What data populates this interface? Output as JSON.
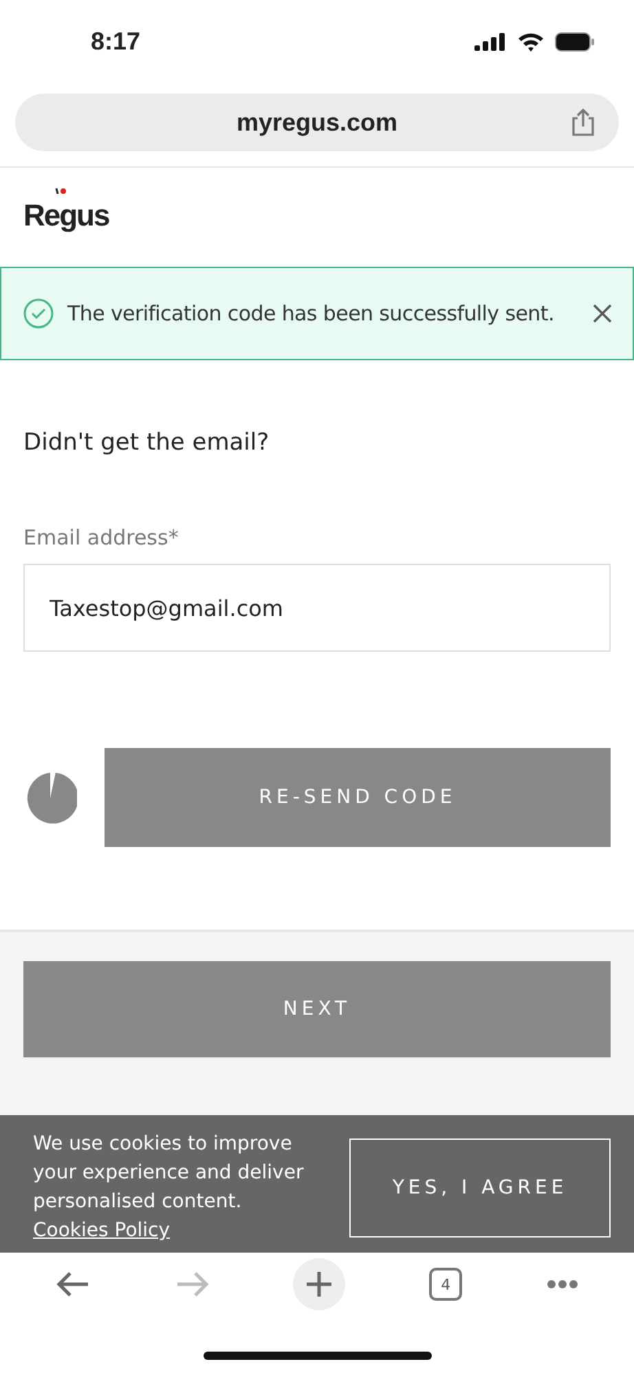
{
  "status_bar": {
    "time": "8:17"
  },
  "browser": {
    "url": "myregus.com"
  },
  "header": {
    "logo": "Regus"
  },
  "alert": {
    "message": "The verification code has been successfully sent."
  },
  "form": {
    "heading": "Didn't get the email?",
    "email_label": "Email address*",
    "email_value": "Taxestop@gmail.com",
    "resend_button": "RE-SEND CODE",
    "next_button": "NEXT"
  },
  "cookie_banner": {
    "text": "We use cookies to improve your experience and deliver personalised content. ",
    "link": "Cookies Policy",
    "button": "YES, I AGREE"
  },
  "toolbar": {
    "tab_count": "4",
    "forward_disabled": true
  }
}
